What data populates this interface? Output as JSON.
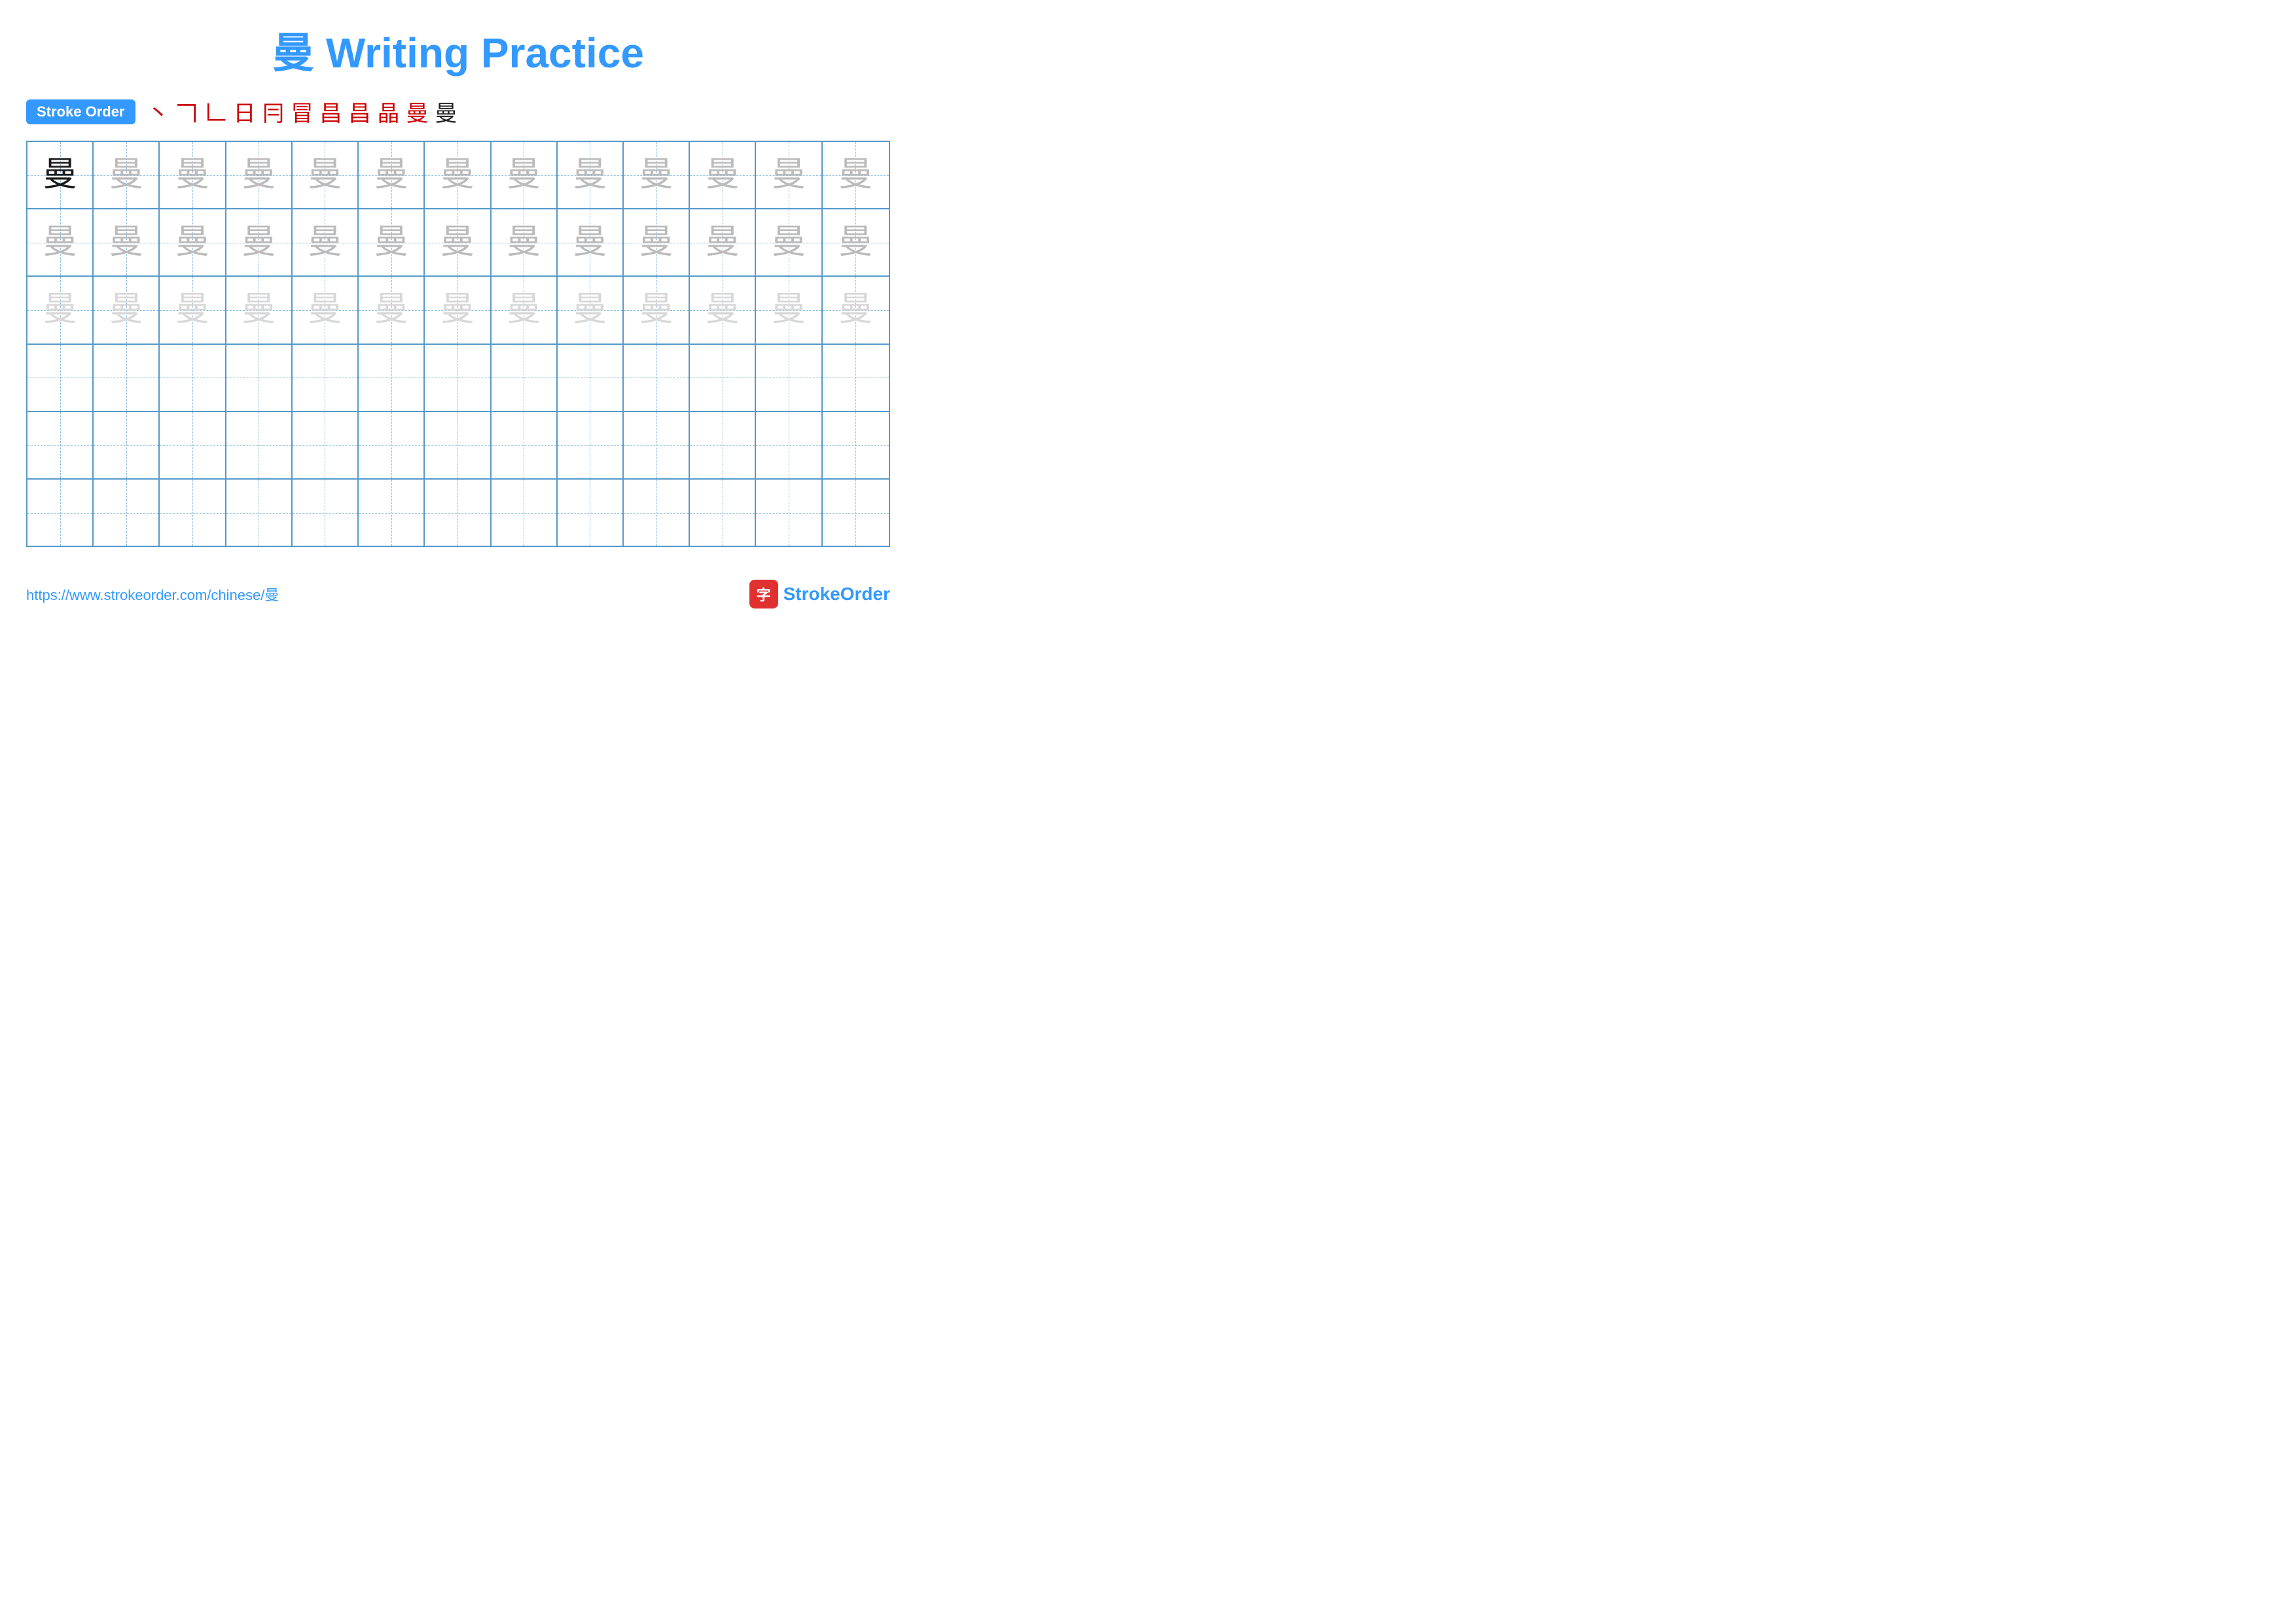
{
  "title": {
    "char": "曼",
    "text": " Writing Practice"
  },
  "stroke_order": {
    "badge_label": "Stroke Order",
    "strokes": [
      "丶",
      "𠃍",
      "𠃊",
      "日",
      "𠃊日",
      "𠅃",
      "𠅃昌",
      "𠅃昌",
      "𠅃昌",
      "𠅃曼",
      "曼"
    ]
  },
  "grid": {
    "rows": 6,
    "cols": 13,
    "char": "曼",
    "row_styles": [
      [
        "dark",
        "medium",
        "medium",
        "medium",
        "medium",
        "medium",
        "medium",
        "medium",
        "medium",
        "medium",
        "medium",
        "medium",
        "medium"
      ],
      [
        "medium",
        "medium",
        "medium",
        "medium",
        "medium",
        "medium",
        "medium",
        "medium",
        "medium",
        "medium",
        "medium",
        "medium",
        "medium"
      ],
      [
        "light",
        "light",
        "light",
        "light",
        "light",
        "light",
        "light",
        "light",
        "light",
        "light",
        "light",
        "light",
        "light"
      ],
      [
        "empty",
        "empty",
        "empty",
        "empty",
        "empty",
        "empty",
        "empty",
        "empty",
        "empty",
        "empty",
        "empty",
        "empty",
        "empty"
      ],
      [
        "empty",
        "empty",
        "empty",
        "empty",
        "empty",
        "empty",
        "empty",
        "empty",
        "empty",
        "empty",
        "empty",
        "empty",
        "empty"
      ],
      [
        "empty",
        "empty",
        "empty",
        "empty",
        "empty",
        "empty",
        "empty",
        "empty",
        "empty",
        "empty",
        "empty",
        "empty",
        "empty"
      ]
    ]
  },
  "footer": {
    "url": "https://www.strokeorder.com/chinese/曼",
    "brand_icon": "字",
    "brand_name_part1": "Stroke",
    "brand_name_part2": "Order"
  }
}
